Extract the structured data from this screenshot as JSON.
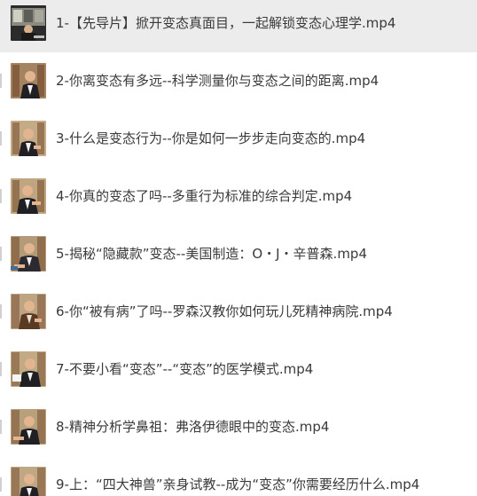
{
  "files": [
    {
      "name": "1-【先导片】掀开变态真面目，一起解锁变态心理学.mp4",
      "thumbnail": "thumbnail-icon"
    },
    {
      "name": "2-你离变态有多远--科学测量你与变态之间的距离.mp4",
      "thumbnail": "thumbnail-icon"
    },
    {
      "name": "3-什么是变态行为--你是如何一步步走向变态的.mp4",
      "thumbnail": "thumbnail-icon"
    },
    {
      "name": "4-你真的变态了吗--多重行为标准的综合判定.mp4",
      "thumbnail": "thumbnail-icon"
    },
    {
      "name": "5-揭秘“隐藏款”变态--美国制造：O・J・辛普森.mp4",
      "thumbnail": "thumbnail-icon"
    },
    {
      "name": "6-你“被有病”了吗--罗森汉教你如何玩儿死精神病院.mp4",
      "thumbnail": "thumbnail-icon"
    },
    {
      "name": "7-不要小看“变态”--“变态”的医学模式.mp4",
      "thumbnail": "thumbnail-icon"
    },
    {
      "name": "8-精神分析学鼻祖：弗洛伊德眼中的变态.mp4",
      "thumbnail": "thumbnail-icon"
    },
    {
      "name": "9-上：“四大神兽”亲身试教--成为“变态”你需要经历什么.mp4",
      "thumbnail": "thumbnail-icon"
    }
  ],
  "colors": {
    "selected_row": "#ececec",
    "text": "#3a3a3a",
    "shelf_bg": "#c7b08e",
    "suit": "#1f1f24",
    "shirt": "#f2f2f2",
    "skin": "#e2b48f"
  }
}
